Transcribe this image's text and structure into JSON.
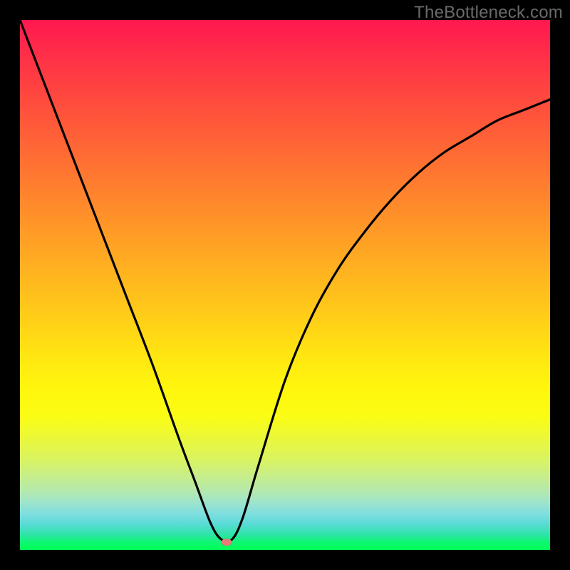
{
  "watermark": "TheBottleneck.com",
  "colors": {
    "background": "#000000",
    "curve": "#000000",
    "dot": "#e77a7a",
    "watermark_text": "#6a6a6a"
  },
  "chart_data": {
    "type": "line",
    "title": "",
    "xlabel": "",
    "ylabel": "",
    "xlim": [
      0,
      1
    ],
    "ylim": [
      0,
      1
    ],
    "grid": false,
    "legend": false,
    "annotations": [
      "TheBottleneck.com"
    ],
    "series": [
      {
        "name": "bottleneck-curve",
        "x": [
          0.0,
          0.05,
          0.1,
          0.15,
          0.2,
          0.25,
          0.3,
          0.33,
          0.36,
          0.38,
          0.4,
          0.42,
          0.45,
          0.5,
          0.55,
          0.6,
          0.65,
          0.7,
          0.75,
          0.8,
          0.85,
          0.9,
          0.95,
          1.0
        ],
        "y": [
          1.0,
          0.87,
          0.74,
          0.61,
          0.48,
          0.35,
          0.21,
          0.13,
          0.05,
          0.02,
          0.02,
          0.06,
          0.16,
          0.32,
          0.44,
          0.53,
          0.6,
          0.66,
          0.71,
          0.75,
          0.78,
          0.81,
          0.83,
          0.85
        ]
      }
    ],
    "marker": {
      "x": 0.39,
      "y": 0.015,
      "color": "#e77a7a"
    },
    "background_gradient_stops": [
      {
        "pos": 0.0,
        "color": "#ff1850"
      },
      {
        "pos": 0.5,
        "color": "#ffca19"
      },
      {
        "pos": 0.75,
        "color": "#fafc16"
      },
      {
        "pos": 1.0,
        "color": "#00ff55"
      }
    ]
  }
}
